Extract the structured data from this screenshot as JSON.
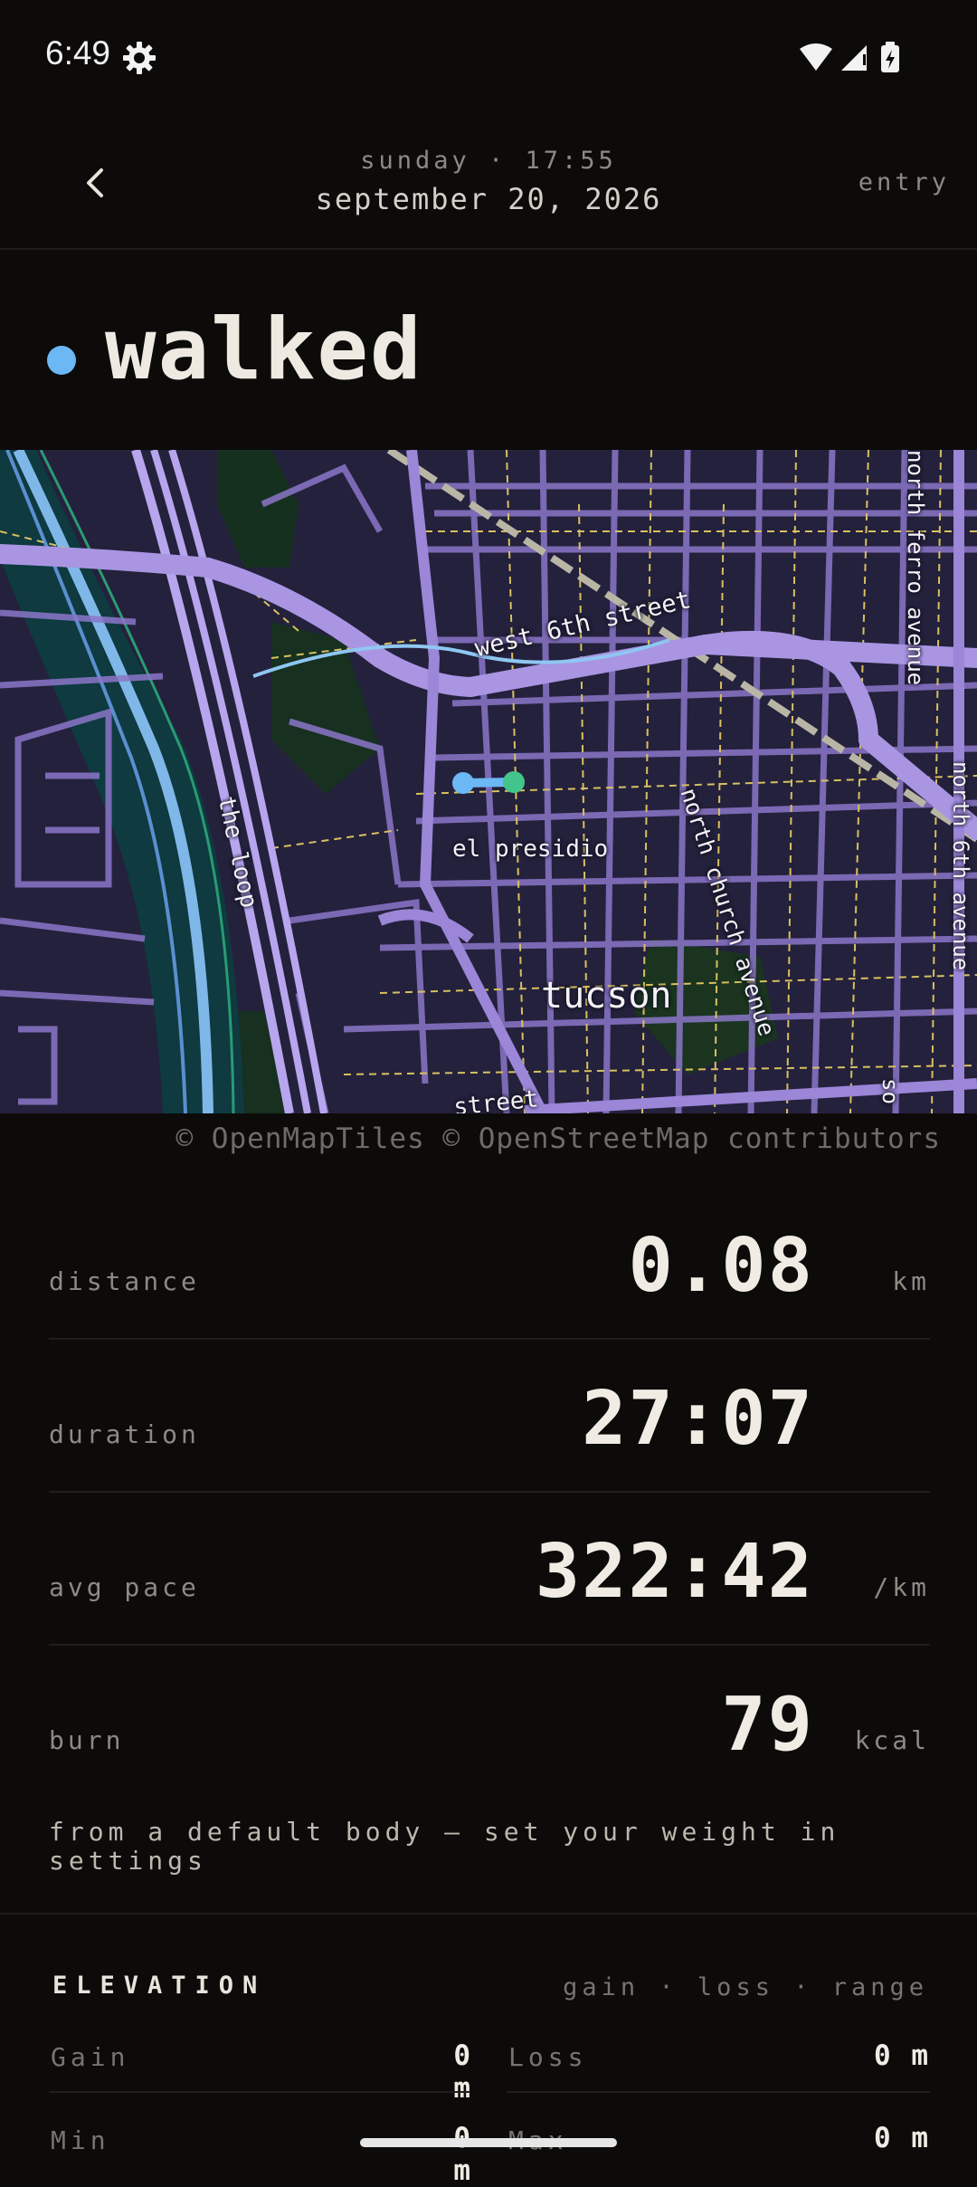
{
  "status_bar": {
    "time": "6:49",
    "left_icon": "gear-icon",
    "right_icons": [
      "wifi-icon",
      "signal-icon",
      "battery-charging-icon"
    ]
  },
  "header": {
    "back_icon": "chevron-left-icon",
    "day_time": "sunday · 17:55",
    "date": "september 20, 2026",
    "right_label": "entry"
  },
  "activity": {
    "title": "walked",
    "dot_color": "#6cb8f5"
  },
  "map": {
    "labels": {
      "street_west_6th": "west 6th street",
      "el_presidio": "el presidio",
      "the_loop": "the loop",
      "north_church": "north church avenue",
      "north_fifth": "north ferro avenue",
      "north_6th": "north 6th avenue",
      "city": "tucson",
      "bottom_street": "street",
      "bottom_so": "so"
    },
    "route": {
      "start_color": "#6cb8f5",
      "end_color": "#43c48a"
    },
    "attribution": "© OpenMapTiles © OpenStreetMap contributors"
  },
  "stats": [
    {
      "label": "distance",
      "value": "0.08",
      "unit": "km"
    },
    {
      "label": "duration",
      "value": "27:07",
      "unit": ""
    },
    {
      "label": "avg pace",
      "value": "322:42",
      "unit": "/km"
    },
    {
      "label": "burn",
      "value": "79",
      "unit": "kcal"
    }
  ],
  "burn_note": "from a default body — set your weight in settings",
  "elevation": {
    "title": "ELEVATION",
    "subtitle": "gain · loss · range",
    "metrics": [
      {
        "label": "Gain",
        "value": "0 m"
      },
      {
        "label": "Loss",
        "value": "0 m"
      },
      {
        "label": "Min",
        "value": "0 m"
      },
      {
        "label": "Max",
        "value": "0 m"
      }
    ]
  }
}
